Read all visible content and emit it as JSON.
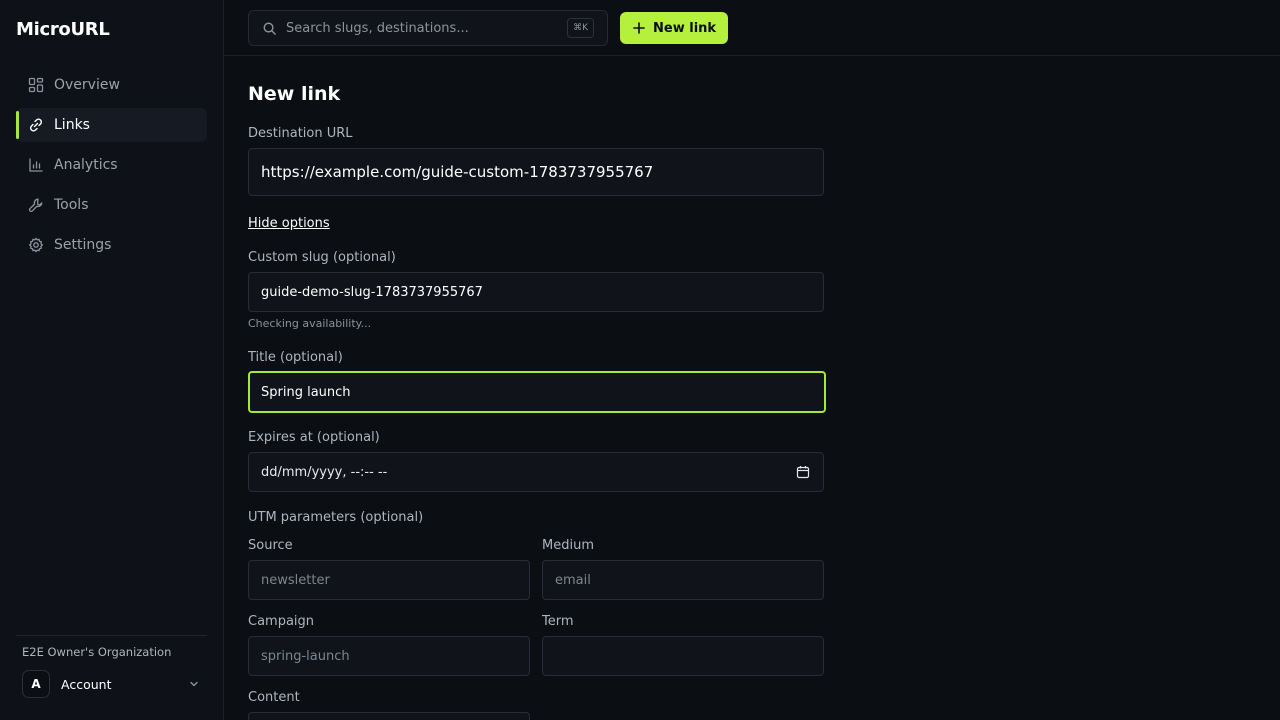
{
  "app": {
    "name": "MicroURL"
  },
  "sidebar": {
    "items": [
      {
        "label": "Overview",
        "icon": "grid-icon"
      },
      {
        "label": "Links",
        "icon": "link-icon",
        "active": true
      },
      {
        "label": "Analytics",
        "icon": "bar-chart-icon"
      },
      {
        "label": "Tools",
        "icon": "wrench-icon"
      },
      {
        "label": "Settings",
        "icon": "gear-icon"
      }
    ],
    "org_name": "E2E Owner's Organization",
    "account": {
      "avatar_letter": "A",
      "label": "Account"
    }
  },
  "topbar": {
    "search_placeholder": "Search slugs, destinations...",
    "search_shortcut": "⌘K",
    "new_link_label": "New link"
  },
  "colors": {
    "accent": "#b4f03c",
    "background": "#0b0e13",
    "sidebar": "#0e1218"
  },
  "form": {
    "title": "New link",
    "destination": {
      "label": "Destination URL",
      "value": "https://example.com/guide-custom-1783737955767"
    },
    "toggle_options": "Hide options",
    "slug": {
      "label": "Custom slug (optional)",
      "value": "guide-demo-slug-1783737955767",
      "hint": "Checking availability..."
    },
    "title_field": {
      "label": "Title (optional)",
      "value": "Spring launch"
    },
    "expires": {
      "label": "Expires at (optional)",
      "placeholder": "dd/mm/yyyy, --:-- --"
    },
    "utm": {
      "heading": "UTM parameters (optional)",
      "source": {
        "label": "Source",
        "placeholder": "newsletter"
      },
      "medium": {
        "label": "Medium",
        "placeholder": "email"
      },
      "campaign": {
        "label": "Campaign",
        "placeholder": "spring-launch"
      },
      "term": {
        "label": "Term",
        "placeholder": ""
      },
      "content": {
        "label": "Content",
        "placeholder": ""
      }
    }
  }
}
